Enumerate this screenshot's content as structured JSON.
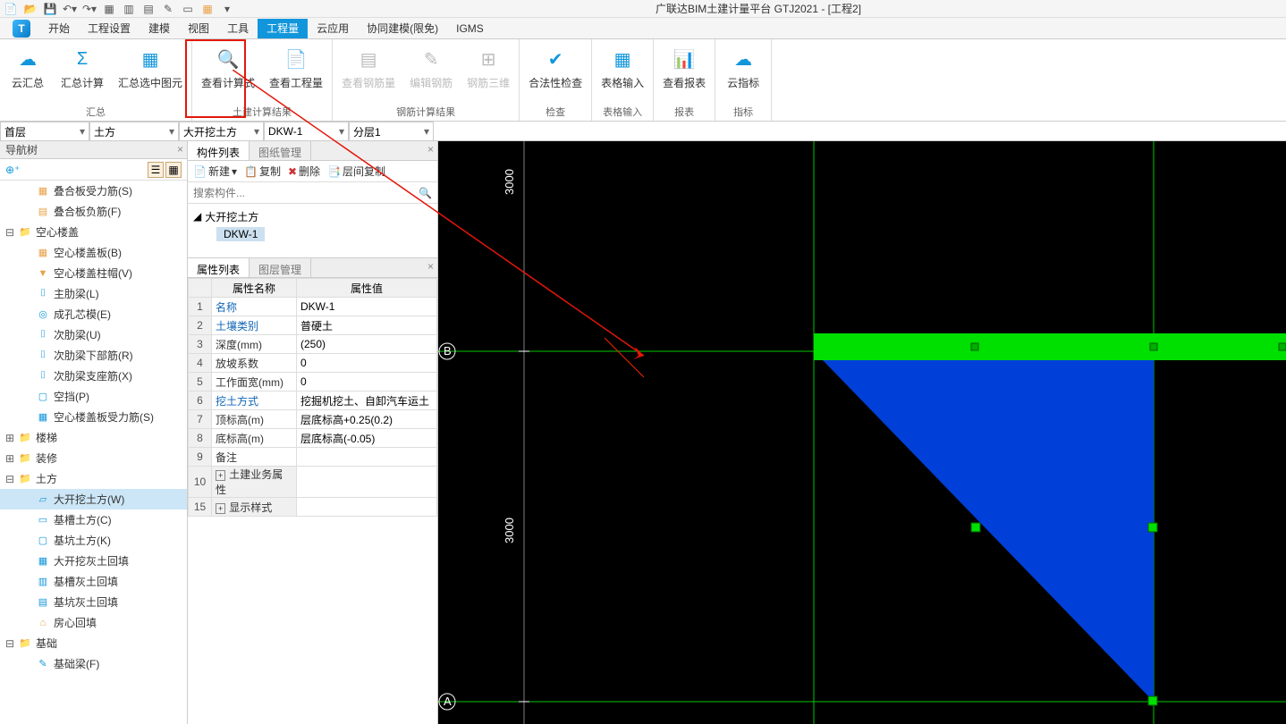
{
  "app": {
    "title": "广联达BIM土建计量平台 GTJ2021 - [工程2]"
  },
  "menu_tabs": [
    "开始",
    "工程设置",
    "建模",
    "视图",
    "工具",
    "工程量",
    "云应用",
    "协同建模(限免)",
    "IGMS"
  ],
  "menu_active": "工程量",
  "ribbon": {
    "groups": [
      {
        "label": "汇总",
        "buttons": [
          {
            "label": "云汇总",
            "icon": "cloud",
            "enabled": true
          },
          {
            "label": "汇总计算",
            "icon": "sigma",
            "enabled": true
          },
          {
            "label": "汇总选中图元",
            "icon": "grid",
            "enabled": true
          }
        ]
      },
      {
        "label": "土建计算结果",
        "buttons": [
          {
            "label": "查看计算式",
            "icon": "calc-mag",
            "enabled": true
          },
          {
            "label": "查看工程量",
            "icon": "doc-mag",
            "enabled": true
          }
        ]
      },
      {
        "label": "钢筋计算结果",
        "buttons": [
          {
            "label": "查看钢筋量",
            "icon": "rebar",
            "enabled": false
          },
          {
            "label": "编辑钢筋",
            "icon": "edit-rebar",
            "enabled": false
          },
          {
            "label": "钢筋三维",
            "icon": "rebar-3d",
            "enabled": false
          }
        ]
      },
      {
        "label": "检查",
        "buttons": [
          {
            "label": "合法性检查",
            "icon": "check",
            "enabled": true
          }
        ]
      },
      {
        "label": "表格输入",
        "buttons": [
          {
            "label": "表格输入",
            "icon": "table",
            "enabled": true
          }
        ]
      },
      {
        "label": "报表",
        "buttons": [
          {
            "label": "查看报表",
            "icon": "report",
            "enabled": true
          }
        ]
      },
      {
        "label": "指标",
        "buttons": [
          {
            "label": "云指标",
            "icon": "cloud-chart",
            "enabled": true
          }
        ]
      }
    ]
  },
  "selectors": {
    "floor": "首层",
    "category": "土方",
    "component": "大开挖土方",
    "instance": "DKW-1",
    "layer": "分层1"
  },
  "nav": {
    "title": "导航树",
    "items": [
      {
        "level": 2,
        "label": "叠合板受力筋(S)",
        "glyph": "▦",
        "color": "c-orange"
      },
      {
        "level": 2,
        "label": "叠合板负筋(F)",
        "glyph": "▤",
        "color": "c-orange"
      },
      {
        "level": 0,
        "label": "空心楼盖",
        "expanded": true
      },
      {
        "level": 2,
        "label": "空心楼盖板(B)",
        "glyph": "▦",
        "color": "c-orange"
      },
      {
        "level": 2,
        "label": "空心楼盖柱帽(V)",
        "glyph": "▼",
        "color": "c-orange"
      },
      {
        "level": 2,
        "label": "主肋梁(L)",
        "glyph": "⌷",
        "color": "c-blue"
      },
      {
        "level": 2,
        "label": "成孔芯模(E)",
        "glyph": "◎",
        "color": "c-blue"
      },
      {
        "level": 2,
        "label": "次肋梁(U)",
        "glyph": "⌷",
        "color": "c-blue"
      },
      {
        "level": 2,
        "label": "次肋梁下部筋(R)",
        "glyph": "⌷",
        "color": "c-blue"
      },
      {
        "level": 2,
        "label": "次肋梁支座筋(X)",
        "glyph": "⌷",
        "color": "c-blue"
      },
      {
        "level": 2,
        "label": "空挡(P)",
        "glyph": "▢",
        "color": "c-blue"
      },
      {
        "level": 2,
        "label": "空心楼盖板受力筋(S)",
        "glyph": "▦",
        "color": "c-blue"
      },
      {
        "level": 0,
        "label": "楼梯",
        "expanded": false
      },
      {
        "level": 0,
        "label": "装修",
        "expanded": false
      },
      {
        "level": 0,
        "label": "土方",
        "expanded": true
      },
      {
        "level": 2,
        "label": "大开挖土方(W)",
        "glyph": "▱",
        "color": "c-blue",
        "selected": true
      },
      {
        "level": 2,
        "label": "基槽土方(C)",
        "glyph": "▭",
        "color": "c-blue"
      },
      {
        "level": 2,
        "label": "基坑土方(K)",
        "glyph": "▢",
        "color": "c-blue"
      },
      {
        "level": 2,
        "label": "大开挖灰土回填",
        "glyph": "▦",
        "color": "c-blue"
      },
      {
        "level": 2,
        "label": "基槽灰土回填",
        "glyph": "▥",
        "color": "c-blue"
      },
      {
        "level": 2,
        "label": "基坑灰土回填",
        "glyph": "▤",
        "color": "c-blue"
      },
      {
        "level": 2,
        "label": "房心回填",
        "glyph": "⌂",
        "color": "c-orange"
      },
      {
        "level": 0,
        "label": "基础",
        "expanded": true
      },
      {
        "level": 2,
        "label": "基础梁(F)",
        "glyph": "✎",
        "color": "c-blue"
      }
    ]
  },
  "component_panel": {
    "tab1": "构件列表",
    "tab2": "图纸管理",
    "toolbar": {
      "new": "新建",
      "copy": "复制",
      "delete": "删除",
      "layercopy": "层间复制"
    },
    "search_placeholder": "搜索构件...",
    "tree_parent": "大开挖土方",
    "tree_child": "DKW-1"
  },
  "property_panel": {
    "tab1": "属性列表",
    "tab2": "图层管理",
    "col_name": "属性名称",
    "col_value": "属性值",
    "rows": [
      {
        "idx": "1",
        "name": "名称",
        "value": "DKW-1",
        "blue": true
      },
      {
        "idx": "2",
        "name": "土壤类别",
        "value": "普硬土",
        "blue": true
      },
      {
        "idx": "3",
        "name": "深度(mm)",
        "value": "(250)",
        "blue": false
      },
      {
        "idx": "4",
        "name": "放坡系数",
        "value": "0",
        "blue": false
      },
      {
        "idx": "5",
        "name": "工作面宽(mm)",
        "value": "0",
        "blue": false
      },
      {
        "idx": "6",
        "name": "挖土方式",
        "value": "挖掘机挖土、自卸汽车运土",
        "blue": true
      },
      {
        "idx": "7",
        "name": "顶标高(m)",
        "value": "层底标高+0.25(0.2)",
        "blue": false
      },
      {
        "idx": "8",
        "name": "底标高(m)",
        "value": "层底标高(-0.05)",
        "blue": false
      },
      {
        "idx": "9",
        "name": "备注",
        "value": "",
        "blue": false
      },
      {
        "idx": "10",
        "name": "土建业务属性",
        "value": "",
        "blue": false,
        "exp": true
      },
      {
        "idx": "15",
        "name": "显示样式",
        "value": "",
        "blue": false,
        "exp": true
      }
    ]
  },
  "viewport": {
    "dim1": "3000",
    "dim2": "3000",
    "axisA": "A",
    "axisB": "B"
  }
}
